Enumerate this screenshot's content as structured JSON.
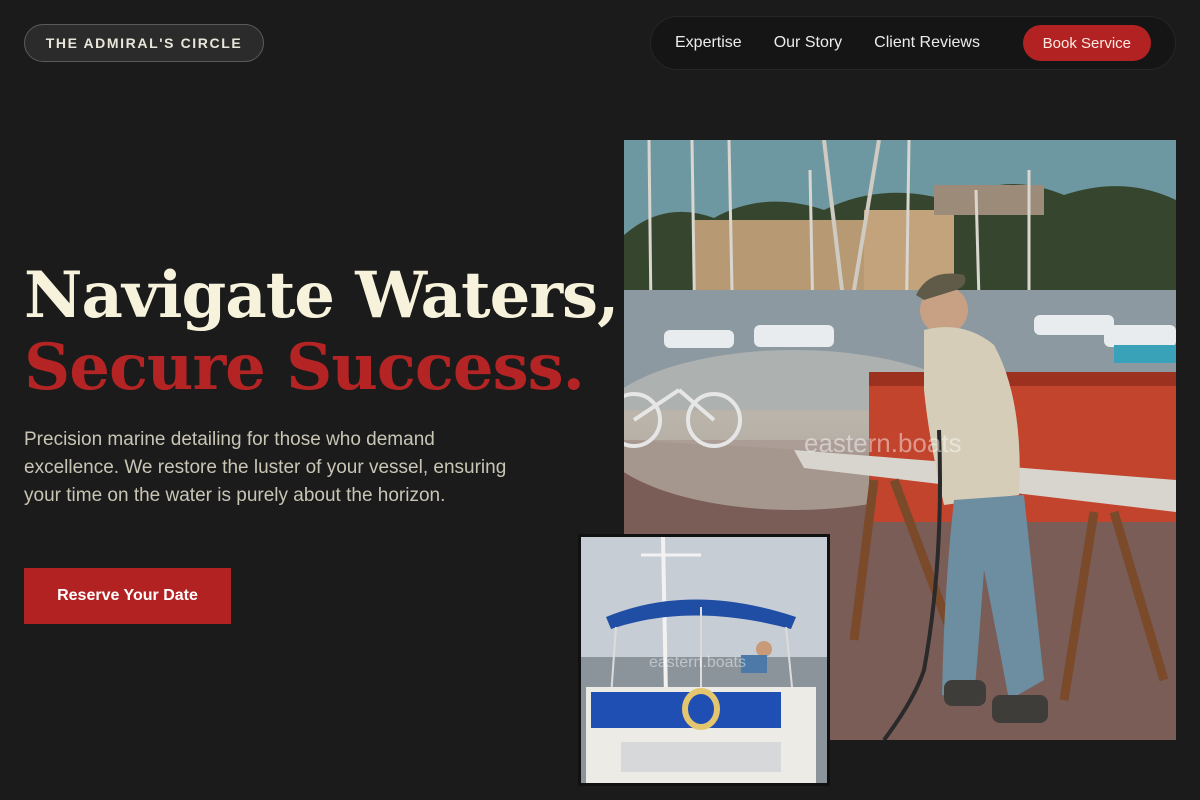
{
  "brand": {
    "name": "THE ADMIRAL'S CIRCLE"
  },
  "nav": {
    "links": [
      "Expertise",
      "Our Story",
      "Client Reviews"
    ],
    "cta": "Book Service"
  },
  "hero": {
    "headline_line1": "Navigate Waters,",
    "headline_line2": "Secure Success.",
    "intro": "Precision marine detailing for those who demand excellence. We restore the luster of your vessel, ensuring your time on the water is purely about the horizon.",
    "cta": "Reserve Your Date"
  },
  "images": {
    "main_watermark": "eastern.boats",
    "inset_watermark": "eastern.boats"
  },
  "colors": {
    "background": "#1b1b1b",
    "accent": "#b32222",
    "headline": "#f6f2db"
  }
}
